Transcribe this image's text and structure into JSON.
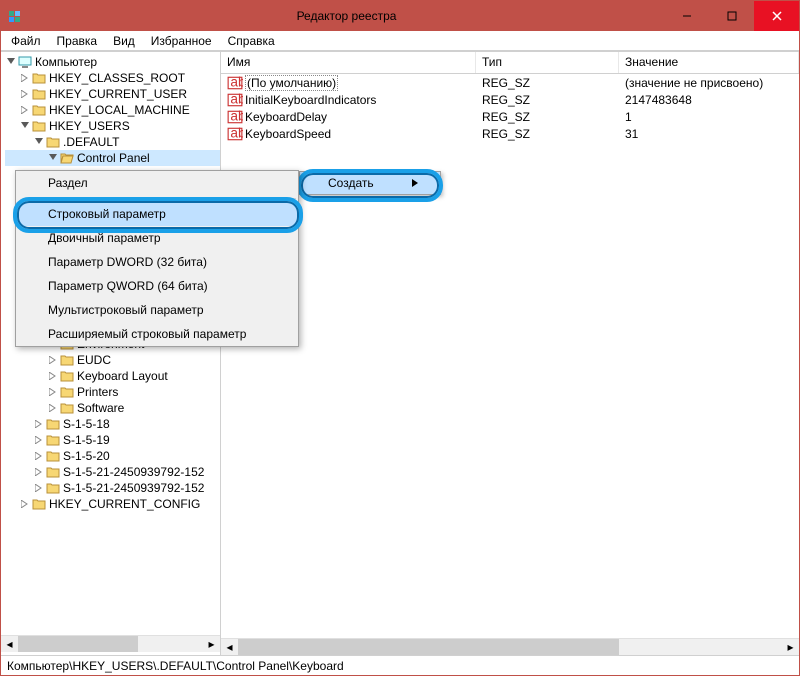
{
  "title": "Редактор реестра",
  "menus": [
    "Файл",
    "Правка",
    "Вид",
    "Избранное",
    "Справка"
  ],
  "tree": {
    "root": "Компьютер",
    "hives": [
      "HKEY_CLASSES_ROOT",
      "HKEY_CURRENT_USER",
      "HKEY_LOCAL_MACHINE",
      "HKEY_USERS"
    ],
    "default_node": ".DEFAULT",
    "control_panel": "Control Panel",
    "cp_children": [
      "Environment",
      "EUDC",
      "Keyboard Layout",
      "Printers",
      "Software"
    ],
    "sids": [
      "S-1-5-18",
      "S-1-5-19",
      "S-1-5-20",
      "S-1-5-21-2450939792-152",
      "S-1-5-21-2450939792-152"
    ],
    "last_hive": "HKEY_CURRENT_CONFIG"
  },
  "columns": {
    "name": "Имя",
    "type": "Тип",
    "value": "Значение"
  },
  "values": [
    {
      "name": "(По умолчанию)",
      "type": "REG_SZ",
      "value": "(значение не присвоено)",
      "boxed": true
    },
    {
      "name": "InitialKeyboardIndicators",
      "type": "REG_SZ",
      "value": "2147483648"
    },
    {
      "name": "KeyboardDelay",
      "type": "REG_SZ",
      "value": "1"
    },
    {
      "name": "KeyboardSpeed",
      "type": "REG_SZ",
      "value": "31"
    }
  ],
  "context_parent": {
    "label": "Создать"
  },
  "context_sub": {
    "key": "Раздел",
    "items": [
      "Строковый параметр",
      "Двоичный параметр",
      "Параметр DWORD (32 бита)",
      "Параметр QWORD (64 бита)",
      "Мультистроковый параметр",
      "Расширяемый строковый параметр"
    ]
  },
  "status": "Компьютер\\HKEY_USERS\\.DEFAULT\\Control Panel\\Keyboard"
}
